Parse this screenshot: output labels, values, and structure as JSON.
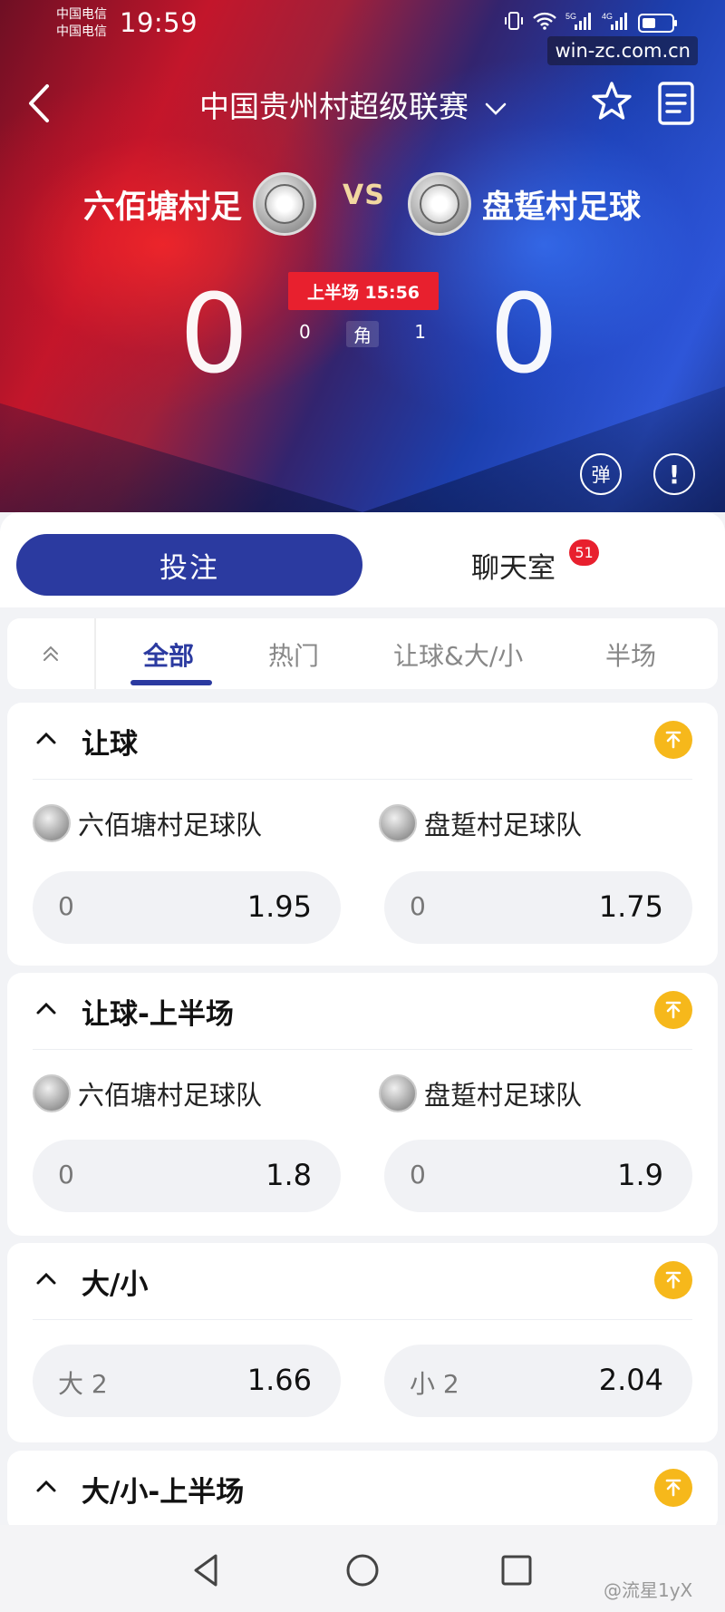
{
  "status": {
    "carrier_1": "中国电信",
    "carrier_2": "中国电信",
    "time": "19:59",
    "net_5g": "5G",
    "net_4g": "4G"
  },
  "watermark": "win-zc.com.cn",
  "nav": {
    "league": "中国贵州村超级联赛"
  },
  "match": {
    "home_team": "六佰塘村足",
    "away_team": "盘踅村足球",
    "vs": "VS",
    "home_score": "0",
    "away_score": "0",
    "period": "上半场 15:56",
    "home_corners": "0",
    "corner_label": "角",
    "away_corners": "1"
  },
  "actions": {
    "danmu": "弹",
    "info": "!"
  },
  "main_tabs": {
    "bet": "投注",
    "chat": "聊天室",
    "chat_count": "51"
  },
  "filters": [
    "全部",
    "热门",
    "让球&大/小",
    "半场"
  ],
  "markets": [
    {
      "title": "让球",
      "home_team": "六佰塘村足球队",
      "away_team": "盘踅村足球队",
      "home": {
        "line": "0",
        "price": "1.95"
      },
      "away": {
        "line": "0",
        "price": "1.75"
      }
    },
    {
      "title": "让球-上半场",
      "home_team": "六佰塘村足球队",
      "away_team": "盘踅村足球队",
      "home": {
        "line": "0",
        "price": "1.8"
      },
      "away": {
        "line": "0",
        "price": "1.9"
      }
    },
    {
      "title": "大/小",
      "over": {
        "line": "大 2",
        "price": "1.66"
      },
      "under": {
        "line": "小 2",
        "price": "2.04"
      }
    },
    {
      "title": "大/小-上半场"
    }
  ],
  "footer_watermark": "@流星1yX",
  "colors": {
    "primary": "#2b3aa0",
    "accent_red": "#e8202e",
    "pin_yellow": "#f6b81b"
  }
}
